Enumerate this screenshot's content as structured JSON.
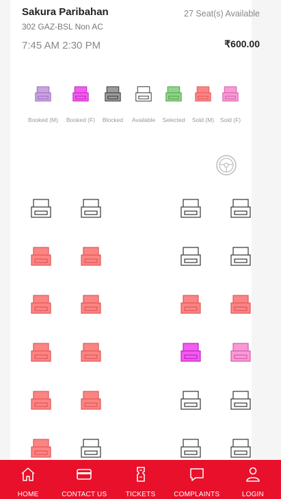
{
  "bus": {
    "name": "Sakura Paribahan",
    "route": "302 GAZ-BSL Non AC",
    "times": "7:45 AM  2:30 PM",
    "seats_available": "27 Seat(s) Available",
    "fare": "₹600.00"
  },
  "legend": [
    {
      "label": "Booked (M)",
      "status": "booked_m"
    },
    {
      "label": "Booked (F)",
      "status": "booked_f"
    },
    {
      "label": "Blocked",
      "status": "blocked"
    },
    {
      "label": "Available",
      "status": "available"
    },
    {
      "label": "Selected",
      "status": "selected"
    },
    {
      "label": "Sold (M)",
      "status": "sold_m"
    },
    {
      "label": "Sold (F)",
      "status": "sold_f"
    }
  ],
  "colors": {
    "booked_m": "#c9a3e0",
    "booked_f": "#f25cf0",
    "blocked": "#9c9c9c",
    "available": "#ffffff",
    "selected": "#8fd48a",
    "sold_m": "#fb8585",
    "sold_f": "#f99ad6",
    "accent": "#e8102a"
  },
  "seat_rows": [
    [
      "available",
      "available",
      "available",
      "available"
    ],
    [
      "sold_m",
      "sold_m",
      "available",
      "available"
    ],
    [
      "sold_m",
      "sold_m",
      "sold_m",
      "sold_m"
    ],
    [
      "sold_m",
      "sold_m",
      "booked_f",
      "sold_f"
    ],
    [
      "sold_m",
      "sold_m",
      "available",
      "available"
    ],
    [
      "sold_m",
      "available",
      "available",
      "available"
    ]
  ],
  "nav": [
    {
      "label": "HOME",
      "icon": "home-icon"
    },
    {
      "label": "CONTACT US",
      "icon": "card-icon"
    },
    {
      "label": "TICKETS",
      "icon": "ticket-icon"
    },
    {
      "label": "COMPLAINTS",
      "icon": "chat-icon"
    },
    {
      "label": "LOGIN",
      "icon": "user-icon"
    }
  ]
}
